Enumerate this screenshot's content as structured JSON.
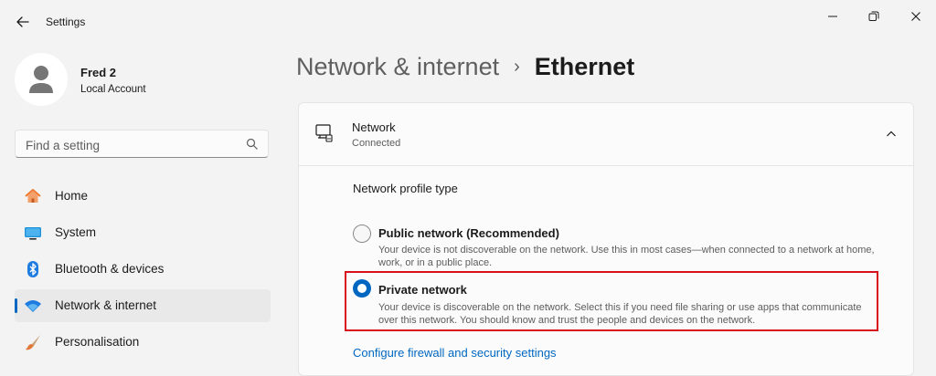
{
  "window": {
    "title": "Settings"
  },
  "user": {
    "name": "Fred 2",
    "account_type": "Local Account"
  },
  "search": {
    "placeholder": "Find a setting"
  },
  "sidebar": {
    "items": [
      {
        "label": "Home",
        "icon": "home-icon",
        "active": false
      },
      {
        "label": "System",
        "icon": "monitor-icon",
        "active": false
      },
      {
        "label": "Bluetooth & devices",
        "icon": "bluetooth-icon",
        "active": false
      },
      {
        "label": "Network & internet",
        "icon": "wifi-icon",
        "active": true
      },
      {
        "label": "Personalisation",
        "icon": "paintbrush-icon",
        "active": false
      }
    ]
  },
  "breadcrumb": {
    "parent": "Network & internet",
    "separator": "›",
    "current": "Ethernet"
  },
  "network_card": {
    "title": "Network",
    "status": "Connected",
    "profile_type_label": "Network profile type",
    "options": [
      {
        "title": "Public network (Recommended)",
        "description": "Your device is not discoverable on the network. Use this in most cases—when connected to a network at home, work, or in a public place.",
        "selected": false
      },
      {
        "title": "Private network",
        "description": "Your device is discoverable on the network. Select this if you need file sharing or use apps that communicate over this network. You should know and trust the people and devices on the network.",
        "selected": true
      }
    ],
    "firewall_link": "Configure firewall and security settings"
  },
  "colors": {
    "accent": "#0067c0",
    "highlight_border": "#d8101b",
    "background": "#f3f3f3",
    "card": "#fbfbfb"
  }
}
